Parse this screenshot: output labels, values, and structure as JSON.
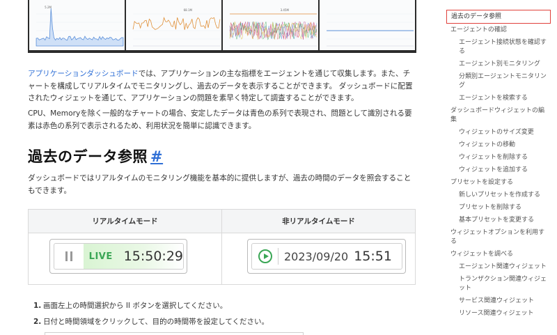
{
  "charts": [
    {
      "kind": "spike-area",
      "label": "5.2M",
      "color": "#5b8fd9"
    },
    {
      "kind": "noisy-line",
      "label": "68.1M",
      "color": "#e0913a"
    },
    {
      "kind": "multi-noise",
      "label": "3.45M",
      "color": "#c04a8f"
    },
    {
      "kind": "flat-line",
      "label": "",
      "color": "#5b8fd9"
    }
  ],
  "content": {
    "intro_link": "アプリケーションダッシュボード",
    "intro_rest": "では、アプリケーションの主な指標をエージェントを通じて収集します。また、チャートを構成してリアルタイムでモニタリングし、過去のデータを表示することができます。 ダッシュボードに配置されたウィジェットを通じて、アプリケーションの問題を素早く特定して調査することができます。",
    "para2": "CPU、Memoryを除く一般的なチャートの場合、安定したデータは青色の系列で表現され、問題として識別される要素は赤色の系列で表示されるため、利用状況を簡単に認識できます。",
    "heading": "過去のデータ参照",
    "heading_anchor": "#",
    "para3": "ダッシュボードではリアルタイムのモニタリング機能を基本的に提供しますが、過去の時間のデータを照会することもできます。",
    "table": {
      "col1": "リアルタイムモード",
      "col2": "非リアルタイムモード",
      "live_label": "LIVE",
      "live_time": "15:50:29",
      "hist_date": "2023/09/20",
      "hist_time": "15:51"
    },
    "steps": [
      {
        "num": "1.",
        "text": "画面左上の時間選択から II ボタンを選択してください。"
      },
      {
        "num": "2.",
        "text": "日付と時間領域をクリックして、目的の時間帯を設定してください。"
      }
    ]
  },
  "toc": [
    {
      "label": "過去のデータ参照",
      "level": 1,
      "active": true
    },
    {
      "label": "エージェントの確認",
      "level": 1
    },
    {
      "label": "エージェント接続状態を確認する",
      "level": 2
    },
    {
      "label": "エージェント別モニタリング",
      "level": 2
    },
    {
      "label": "分類別エージェントモニタリング",
      "level": 2
    },
    {
      "label": "エージェントを検索する",
      "level": 2
    },
    {
      "label": "ダッシュボードウィジェットの編集",
      "level": 1
    },
    {
      "label": "ウィジェットのサイズ変更",
      "level": 2
    },
    {
      "label": "ウィジェットの移動",
      "level": 2
    },
    {
      "label": "ウィジェットを削除する",
      "level": 2
    },
    {
      "label": "ウィジェットを追加する",
      "level": 2
    },
    {
      "label": "プリセットを設定する",
      "level": 1
    },
    {
      "label": "新しいプリセットを作成する",
      "level": 2
    },
    {
      "label": "プリセットを削除する",
      "level": 2
    },
    {
      "label": "基本プリセットを変更する",
      "level": 2
    },
    {
      "label": "ウィジェットオプションを利用する",
      "level": 1
    },
    {
      "label": "ウィジェットを調べる",
      "level": 1
    },
    {
      "label": "エージェント関連ウィジェット",
      "level": 2
    },
    {
      "label": "トランザクション関連ウィジェット",
      "level": 2
    },
    {
      "label": "サービス関連ウィジェット",
      "level": 2
    },
    {
      "label": "リソース関連ウィジェット",
      "level": 2
    }
  ]
}
